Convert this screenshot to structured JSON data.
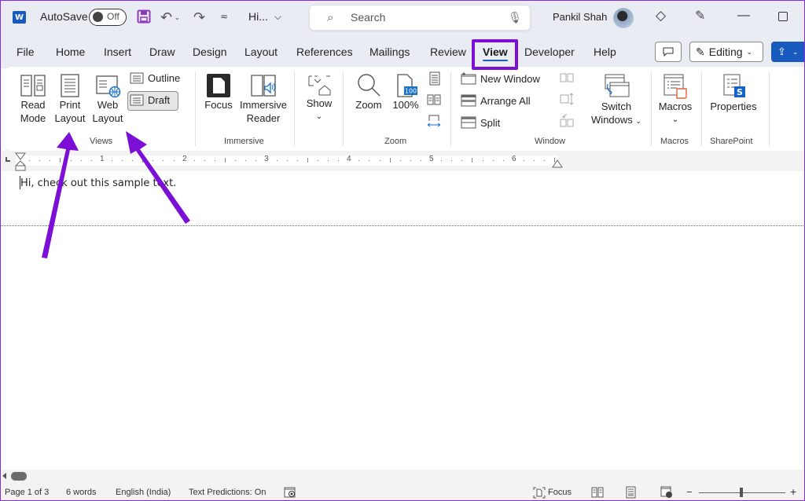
{
  "titlebar": {
    "app_logo": "W",
    "autosave_label": "AutoSave",
    "autosave_state": "Off",
    "doc_name": "Hi...",
    "search_placeholder": "Search",
    "user_name": "Pankil Shah"
  },
  "tabs": [
    {
      "label": "File"
    },
    {
      "label": "Home"
    },
    {
      "label": "Insert"
    },
    {
      "label": "Draw"
    },
    {
      "label": "Design"
    },
    {
      "label": "Layout"
    },
    {
      "label": "References"
    },
    {
      "label": "Mailings"
    },
    {
      "label": "Review"
    },
    {
      "label": "View",
      "active": true
    },
    {
      "label": "Developer"
    },
    {
      "label": "Help"
    }
  ],
  "tab_actions": {
    "editing_label": "Editing"
  },
  "ribbon": {
    "views": {
      "label": "Views",
      "read_mode": [
        "Read",
        "Mode"
      ],
      "print_layout": [
        "Print",
        "Layout"
      ],
      "web_layout": [
        "Web",
        "Layout"
      ],
      "outline": "Outline",
      "draft": "Draft"
    },
    "immersive": {
      "label": "Immersive",
      "focus": "Focus",
      "immersive_reader": [
        "Immersive",
        "Reader"
      ]
    },
    "show": {
      "label": "Show"
    },
    "zoom": {
      "label": "Zoom",
      "zoom": "Zoom",
      "hundred": "100%",
      "hundred_badge": "100"
    },
    "window": {
      "label": "Window",
      "new_window": "New Window",
      "arrange_all": "Arrange All",
      "split": "Split",
      "switch_windows": [
        "Switch",
        "Windows"
      ]
    },
    "macros": {
      "label": "Macros",
      "macros": "Macros"
    },
    "sharepoint": {
      "label": "SharePoint",
      "properties": "Properties",
      "badge": "S"
    }
  },
  "ruler": {
    "numbers": [
      "1",
      "2",
      "3",
      "4",
      "5",
      "6"
    ]
  },
  "document": {
    "text": "Hi, check out this sample text."
  },
  "statusbar": {
    "page": "Page 1 of 3",
    "words": "6 words",
    "language": "English (India)",
    "predictions": "Text Predictions: On",
    "focus": "Focus",
    "zoom_minus": "−",
    "zoom_plus": "+"
  },
  "colors": {
    "accent": "#185abd",
    "annotation": "#7b0fd6"
  }
}
